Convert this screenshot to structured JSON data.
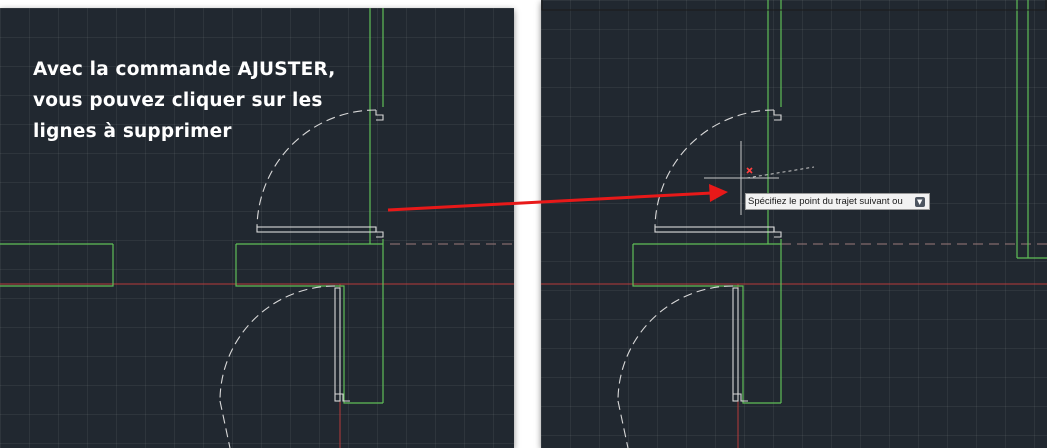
{
  "annotation": {
    "text": "Avec la commande AJUSTER,\nvous pouvez cliquer sur les\nlignes à supprimer"
  },
  "tooltip": {
    "text": "Spécifiez le point du trajet suivant ou",
    "dropdown_icon": "chevron-down-icon"
  },
  "colors": {
    "canvas_background": "#212830",
    "wall_lines": "#5fbf57",
    "door_lines": "#d9d9d9",
    "axis_lines": "#b83a3a",
    "arrow": "#e81919",
    "pick_marker": "#ff4040"
  }
}
